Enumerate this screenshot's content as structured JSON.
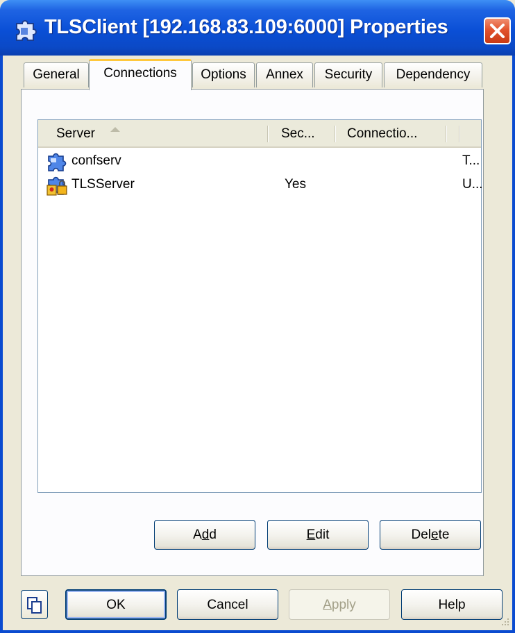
{
  "window": {
    "title": "TLSClient [192.168.83.109:6000] Properties"
  },
  "tabs": [
    {
      "label": "General"
    },
    {
      "label": "Connections",
      "active": true
    },
    {
      "label": "Options"
    },
    {
      "label": "Annex"
    },
    {
      "label": "Security"
    },
    {
      "label": "Dependency"
    }
  ],
  "list": {
    "columns": [
      "Server",
      "Sec...",
      "Connectio..."
    ],
    "sort_column": "Server",
    "sort_direction": "ascending",
    "rows": [
      {
        "icon": "puzzle-icon",
        "server": "confserv",
        "security": "",
        "connection": "T..."
      },
      {
        "icon": "secure-puzzle-icon",
        "server": "TLSServer",
        "security": "Yes",
        "connection": "U..."
      }
    ]
  },
  "panel_buttons": {
    "add": {
      "pre": "A",
      "mnemonic": "d",
      "post": "d"
    },
    "edit": {
      "pre": "",
      "mnemonic": "E",
      "post": "dit"
    },
    "delete": {
      "pre": "Del",
      "mnemonic": "e",
      "post": "te"
    }
  },
  "dialog_buttons": {
    "ok": "OK",
    "cancel": "Cancel",
    "apply": {
      "pre": "",
      "mnemonic": "A",
      "post": "pply"
    },
    "help": "Help"
  },
  "colors": {
    "titlebar": "#0a4fd6",
    "close_button": "#e2532e",
    "active_tab_accent": "#ffc83c",
    "dialog_background": "#ece9d8"
  }
}
